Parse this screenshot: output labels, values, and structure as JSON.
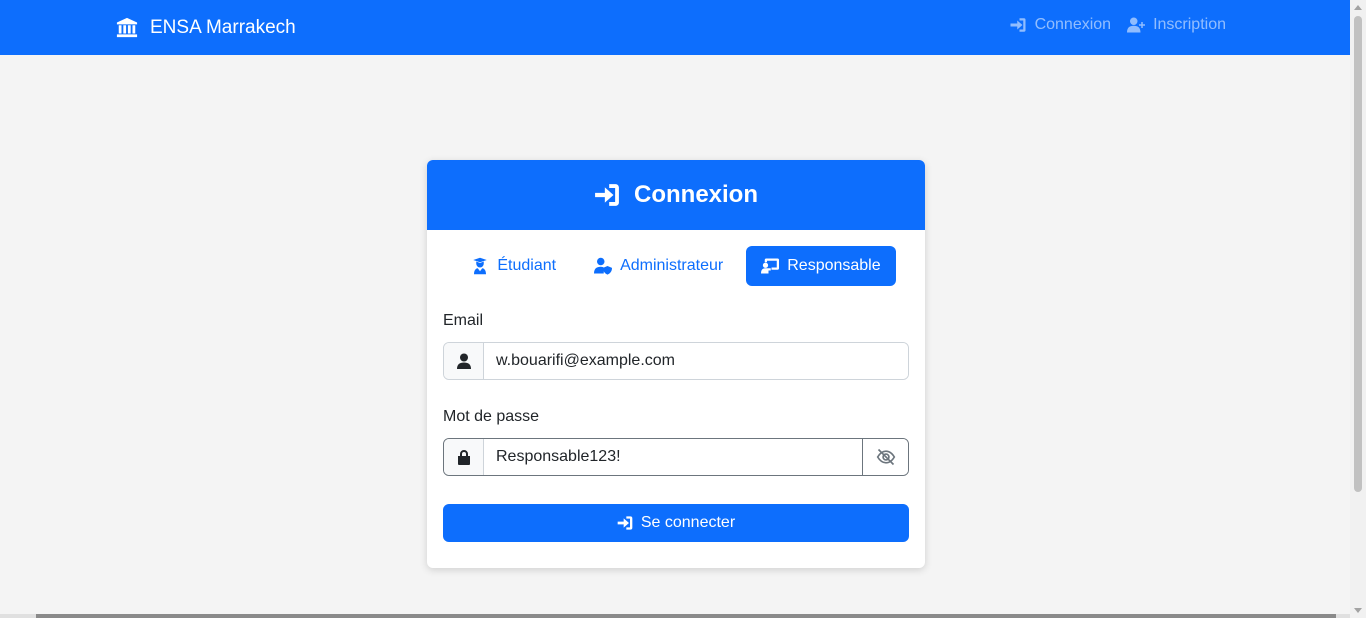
{
  "navbar": {
    "brand": "ENSA Marrakech",
    "brand_icon": "university-icon",
    "links": [
      {
        "label": "Connexion",
        "icon": "sign-in-icon"
      },
      {
        "label": "Inscription",
        "icon": "user-plus-icon"
      }
    ]
  },
  "card": {
    "title": "Connexion",
    "tabs": [
      {
        "label": "Étudiant",
        "icon": "graduate-icon",
        "active": false
      },
      {
        "label": "Administrateur",
        "icon": "user-shield-icon",
        "active": false
      },
      {
        "label": "Responsable",
        "icon": "chalkboard-teacher-icon",
        "active": true
      }
    ],
    "email_label": "Email",
    "email_value": "w.bouarifi@example.com",
    "password_label": "Mot de passe",
    "password_value": "Responsable123!",
    "submit_label": "Se connecter"
  },
  "colors": {
    "primary": "#0d6efd",
    "background": "#f4f4f4"
  }
}
